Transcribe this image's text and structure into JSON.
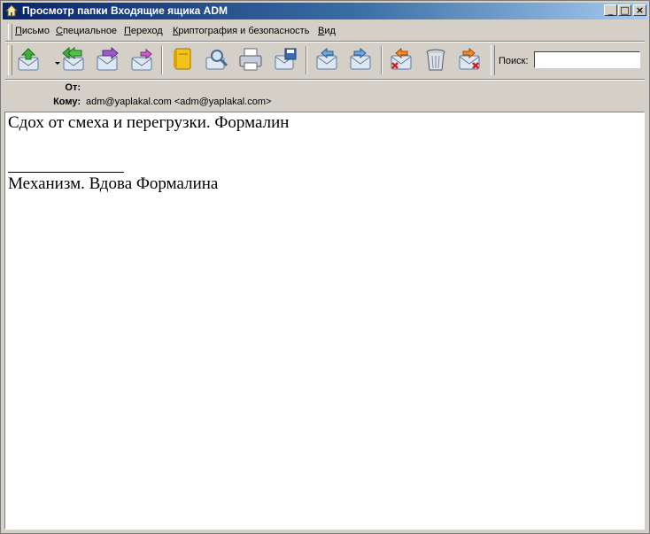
{
  "window": {
    "title": "Просмотр папки Входящие ящика ADM",
    "controls": {
      "minimize": "_",
      "maximize": "□",
      "close": "×"
    }
  },
  "menu": [
    "Письмо",
    "Специальное",
    "Переход",
    "Криптография и безопасность",
    "Вид"
  ],
  "toolbar": {
    "icons": [
      "get-mail-icon",
      "reply-icon",
      "forward-icon",
      "redirect-icon",
      "address-book-icon",
      "find-icon",
      "print-icon",
      "save-icon",
      "previous-message-icon",
      "next-message-icon",
      "delete-icon",
      "trash-icon",
      "delete-junk-icon"
    ],
    "search_label": "Поиск:",
    "search_value": ""
  },
  "headers": {
    "from_label": "От:",
    "from_value": "",
    "to_label": "Кому:",
    "to_value": "adm@yaplakal.com <adm@yaplakal.com>"
  },
  "message": {
    "line1": "Сдох от смеха и перегрузки. Формалин",
    "line2": "Механизм. Вдова Формалина"
  }
}
